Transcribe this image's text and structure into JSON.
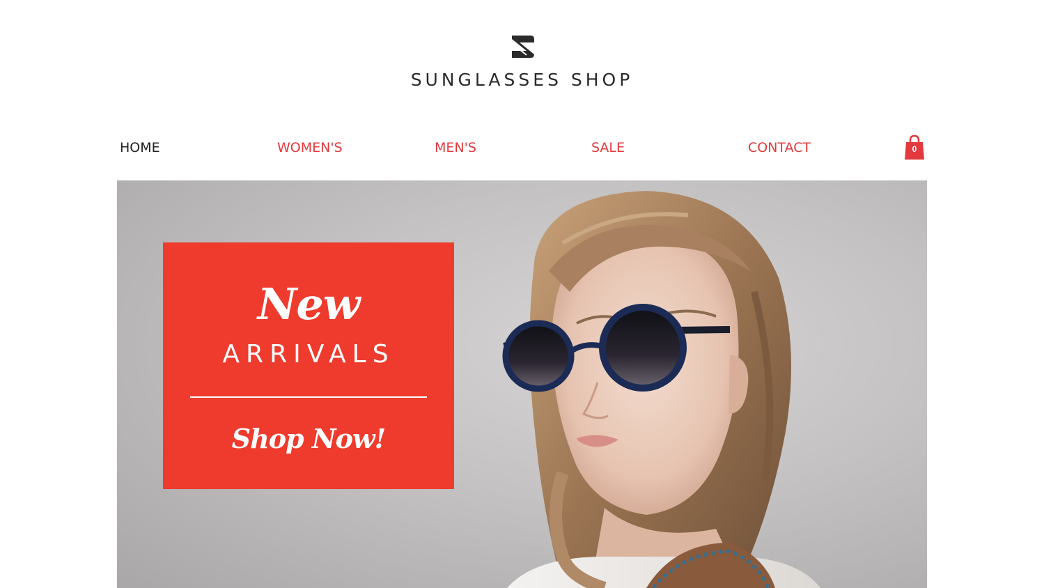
{
  "header": {
    "logo_icon": "s-monogram-logo",
    "brand_name": "SUNGLASSES SHOP"
  },
  "nav": {
    "items": [
      {
        "label": "HOME",
        "active": true
      },
      {
        "label": "WOMEN'S",
        "active": false
      },
      {
        "label": "MEN'S",
        "active": false
      },
      {
        "label": "SALE",
        "active": false
      },
      {
        "label": "CONTACT",
        "active": false
      }
    ],
    "cart": {
      "icon": "shopping-bag-icon",
      "count": "0"
    }
  },
  "hero": {
    "image": "model-wearing-round-sunglasses",
    "promo": {
      "title": "New",
      "subtitle": "ARRIVALS",
      "cta": "Shop Now!"
    }
  },
  "colors": {
    "accent": "#e23a3e",
    "promo_background": "#ef3b2d",
    "text_dark": "#222222"
  }
}
